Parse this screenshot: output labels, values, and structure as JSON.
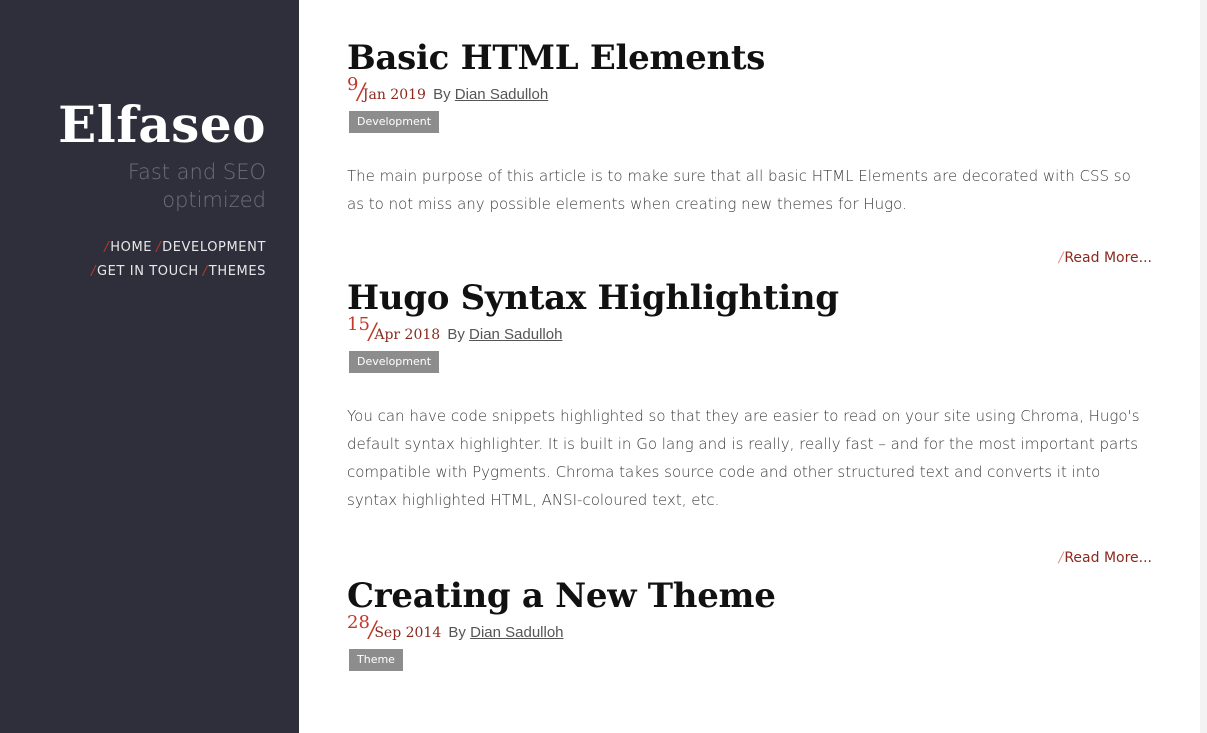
{
  "site": {
    "title": "Elfaseo",
    "tagline": "Fast and SEO optimized",
    "nav": [
      "HOME",
      "DEVELOPMENT",
      "GET IN TOUCH",
      "THEMES"
    ]
  },
  "posts": [
    {
      "title": "Basic HTML Elements",
      "day": "9",
      "month_year": "Jan 2019",
      "by": "By",
      "author": "Dian Sadulloh",
      "tag": "Development",
      "summary": "The main purpose of this article is to make sure that all basic HTML Elements are decorated with CSS so as to not miss any possible elements when creating new themes for Hugo.",
      "read_more": "Read More..."
    },
    {
      "title": "Hugo Syntax Highlighting",
      "day": "15",
      "month_year": "Apr 2018",
      "by": "By",
      "author": "Dian Sadulloh",
      "tag": "Development",
      "summary": "You can have code snippets highlighted so that they are easier to read on your site using Chroma, Hugo's default syntax highlighter. It is built in Go lang and is really, really fast – and for the most important parts compatible with Pygments. Chroma takes source code and other structured text and converts it into syntax highlighted HTML, ANSI-coloured text, etc.",
      "read_more": "Read More..."
    },
    {
      "title": "Creating a New Theme",
      "day": "28",
      "month_year": "Sep 2014",
      "by": "By",
      "author": "Dian Sadulloh",
      "tag": "Theme"
    }
  ],
  "colors": {
    "sidebar_bg": "#2e2f3a",
    "accent": "#c0392b",
    "accent_dark": "#8a2a1f",
    "tag_bg": "#8d8d8d"
  }
}
